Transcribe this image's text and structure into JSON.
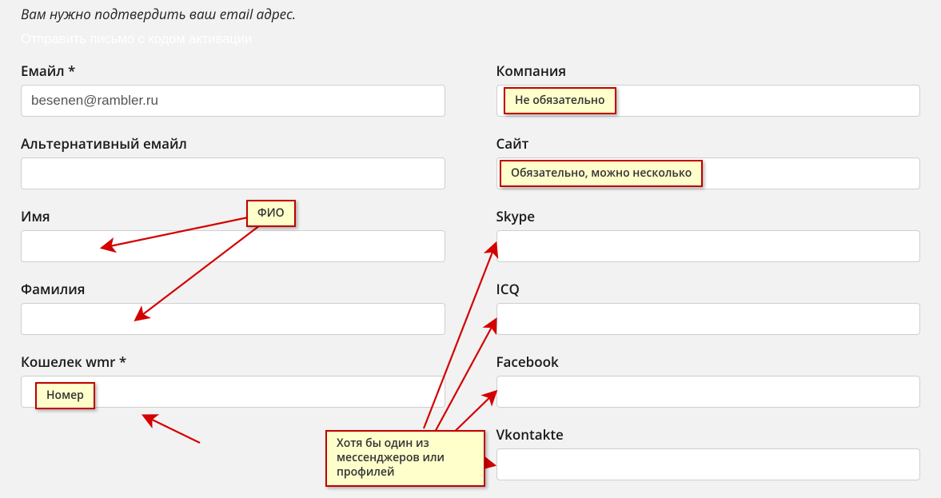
{
  "notice": "Вам нужно подтвердить ваш email адрес.",
  "activation_link": "Отправить письмо с кодом активации",
  "left": {
    "email": {
      "label": "Емайл *",
      "value": "besenen@rambler.ru"
    },
    "alt_email": {
      "label": "Альтернативный емайл",
      "value": ""
    },
    "first_name": {
      "label": "Имя",
      "value": ""
    },
    "last_name": {
      "label": "Фамилия",
      "value": ""
    },
    "wallet": {
      "label": "Кошелек wmr *",
      "value": ""
    }
  },
  "right": {
    "company": {
      "label": "Компания",
      "value": ""
    },
    "site": {
      "label": "Сайт",
      "value": ""
    },
    "skype": {
      "label": "Skype",
      "value": ""
    },
    "icq": {
      "label": "ICQ",
      "value": ""
    },
    "facebook": {
      "label": "Facebook",
      "value": ""
    },
    "vkontakte": {
      "label": "Vkontakte",
      "value": ""
    }
  },
  "annotations": {
    "fio": "ФИО",
    "number": "Номер",
    "company_opt": "Не обязательно",
    "site_req": "Обязательно, можно несколько",
    "messengers": "Хотя бы один из мессенджеров или профилей"
  }
}
